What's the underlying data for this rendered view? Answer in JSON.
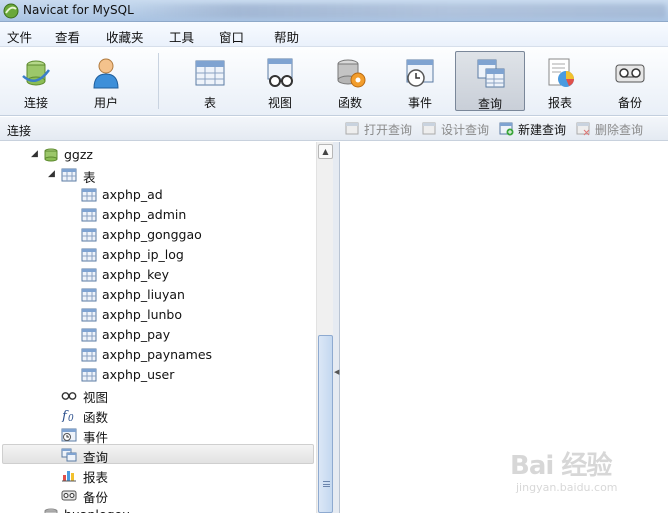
{
  "window": {
    "title": "Navicat for MySQL"
  },
  "menu": [
    "文件",
    "查看",
    "收藏夹",
    "工具",
    "窗口",
    "帮助"
  ],
  "toolbar": {
    "left": [
      {
        "label": "连接",
        "icon": "connection-icon"
      },
      {
        "label": "用户",
        "icon": "user-icon"
      }
    ],
    "right": [
      {
        "label": "表",
        "icon": "table-icon"
      },
      {
        "label": "视图",
        "icon": "view-icon"
      },
      {
        "label": "函数",
        "icon": "function-icon"
      },
      {
        "label": "事件",
        "icon": "event-icon"
      },
      {
        "label": "查询",
        "icon": "query-icon",
        "active": true
      },
      {
        "label": "报表",
        "icon": "report-icon"
      },
      {
        "label": "备份",
        "icon": "backup-icon"
      }
    ]
  },
  "connection_bar": {
    "label": "连接",
    "actions": [
      {
        "label": "打开查询",
        "enabled": false
      },
      {
        "label": "设计查询",
        "enabled": false
      },
      {
        "label": "新建查询",
        "enabled": true
      },
      {
        "label": "删除查询",
        "enabled": false
      }
    ]
  },
  "tree": {
    "database": "ggzz",
    "tables_label": "表",
    "tables": [
      "axphp_ad",
      "axphp_admin",
      "axphp_gonggao",
      "axphp_ip_log",
      "axphp_key",
      "axphp_liuyan",
      "axphp_lunbo",
      "axphp_pay",
      "axphp_paynames",
      "axphp_user"
    ],
    "categories": [
      {
        "label": "视图",
        "icon": "view-icon"
      },
      {
        "label": "函数",
        "icon": "function-icon"
      },
      {
        "label": "事件",
        "icon": "event-icon"
      },
      {
        "label": "查询",
        "icon": "query-icon",
        "selected": true
      },
      {
        "label": "报表",
        "icon": "report-icon"
      },
      {
        "label": "备份",
        "icon": "backup-icon"
      }
    ],
    "next_database": "huanlegou"
  },
  "watermark": {
    "main": "Bai 经验",
    "sub": "jingyan.baidu.com"
  },
  "colors": {
    "accent": "#aac4e3",
    "selected_toolbar": "#c9cfd8",
    "scroll_thumb": "#c4d8f0"
  }
}
